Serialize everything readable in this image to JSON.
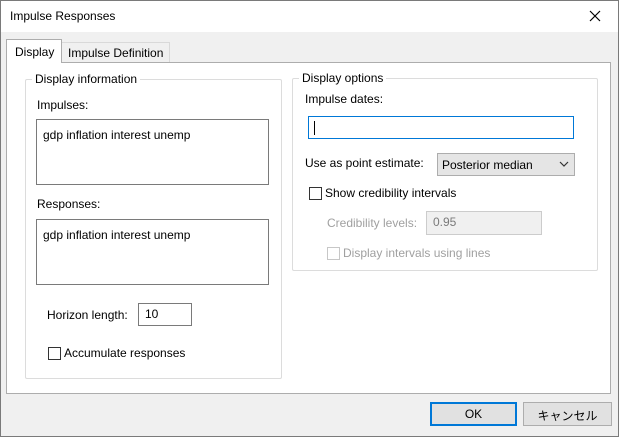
{
  "window": {
    "title": "Impulse Responses"
  },
  "tabs": [
    {
      "label": "Display"
    },
    {
      "label": "Impulse Definition"
    }
  ],
  "display_information": {
    "group_label": "Display information",
    "impulses_label": "Impulses:",
    "impulses_value": "gdp inflation interest unemp",
    "responses_label": "Responses:",
    "responses_value": "gdp inflation interest unemp",
    "horizon_label": "Horizon length:",
    "horizon_value": "10",
    "accumulate_label": "Accumulate responses"
  },
  "display_options": {
    "group_label": "Display options",
    "impulse_dates_label": "Impulse dates:",
    "impulse_dates_value": "",
    "point_estimate_label": "Use as point estimate:",
    "point_estimate_value": "Posterior median",
    "show_intervals_label": "Show credibility intervals",
    "credibility_levels_label": "Credibility levels:",
    "credibility_levels_value": "0.95",
    "display_lines_label": "Display intervals using lines"
  },
  "buttons": {
    "ok": "OK",
    "cancel": "キャンセル"
  },
  "icons": {
    "close": "close-icon",
    "dropdown": "chevron-down-icon"
  },
  "colors": {
    "accent": "#0078d7",
    "dialog_bg": "#f0f0f0",
    "panel_bg": "#ffffff"
  }
}
